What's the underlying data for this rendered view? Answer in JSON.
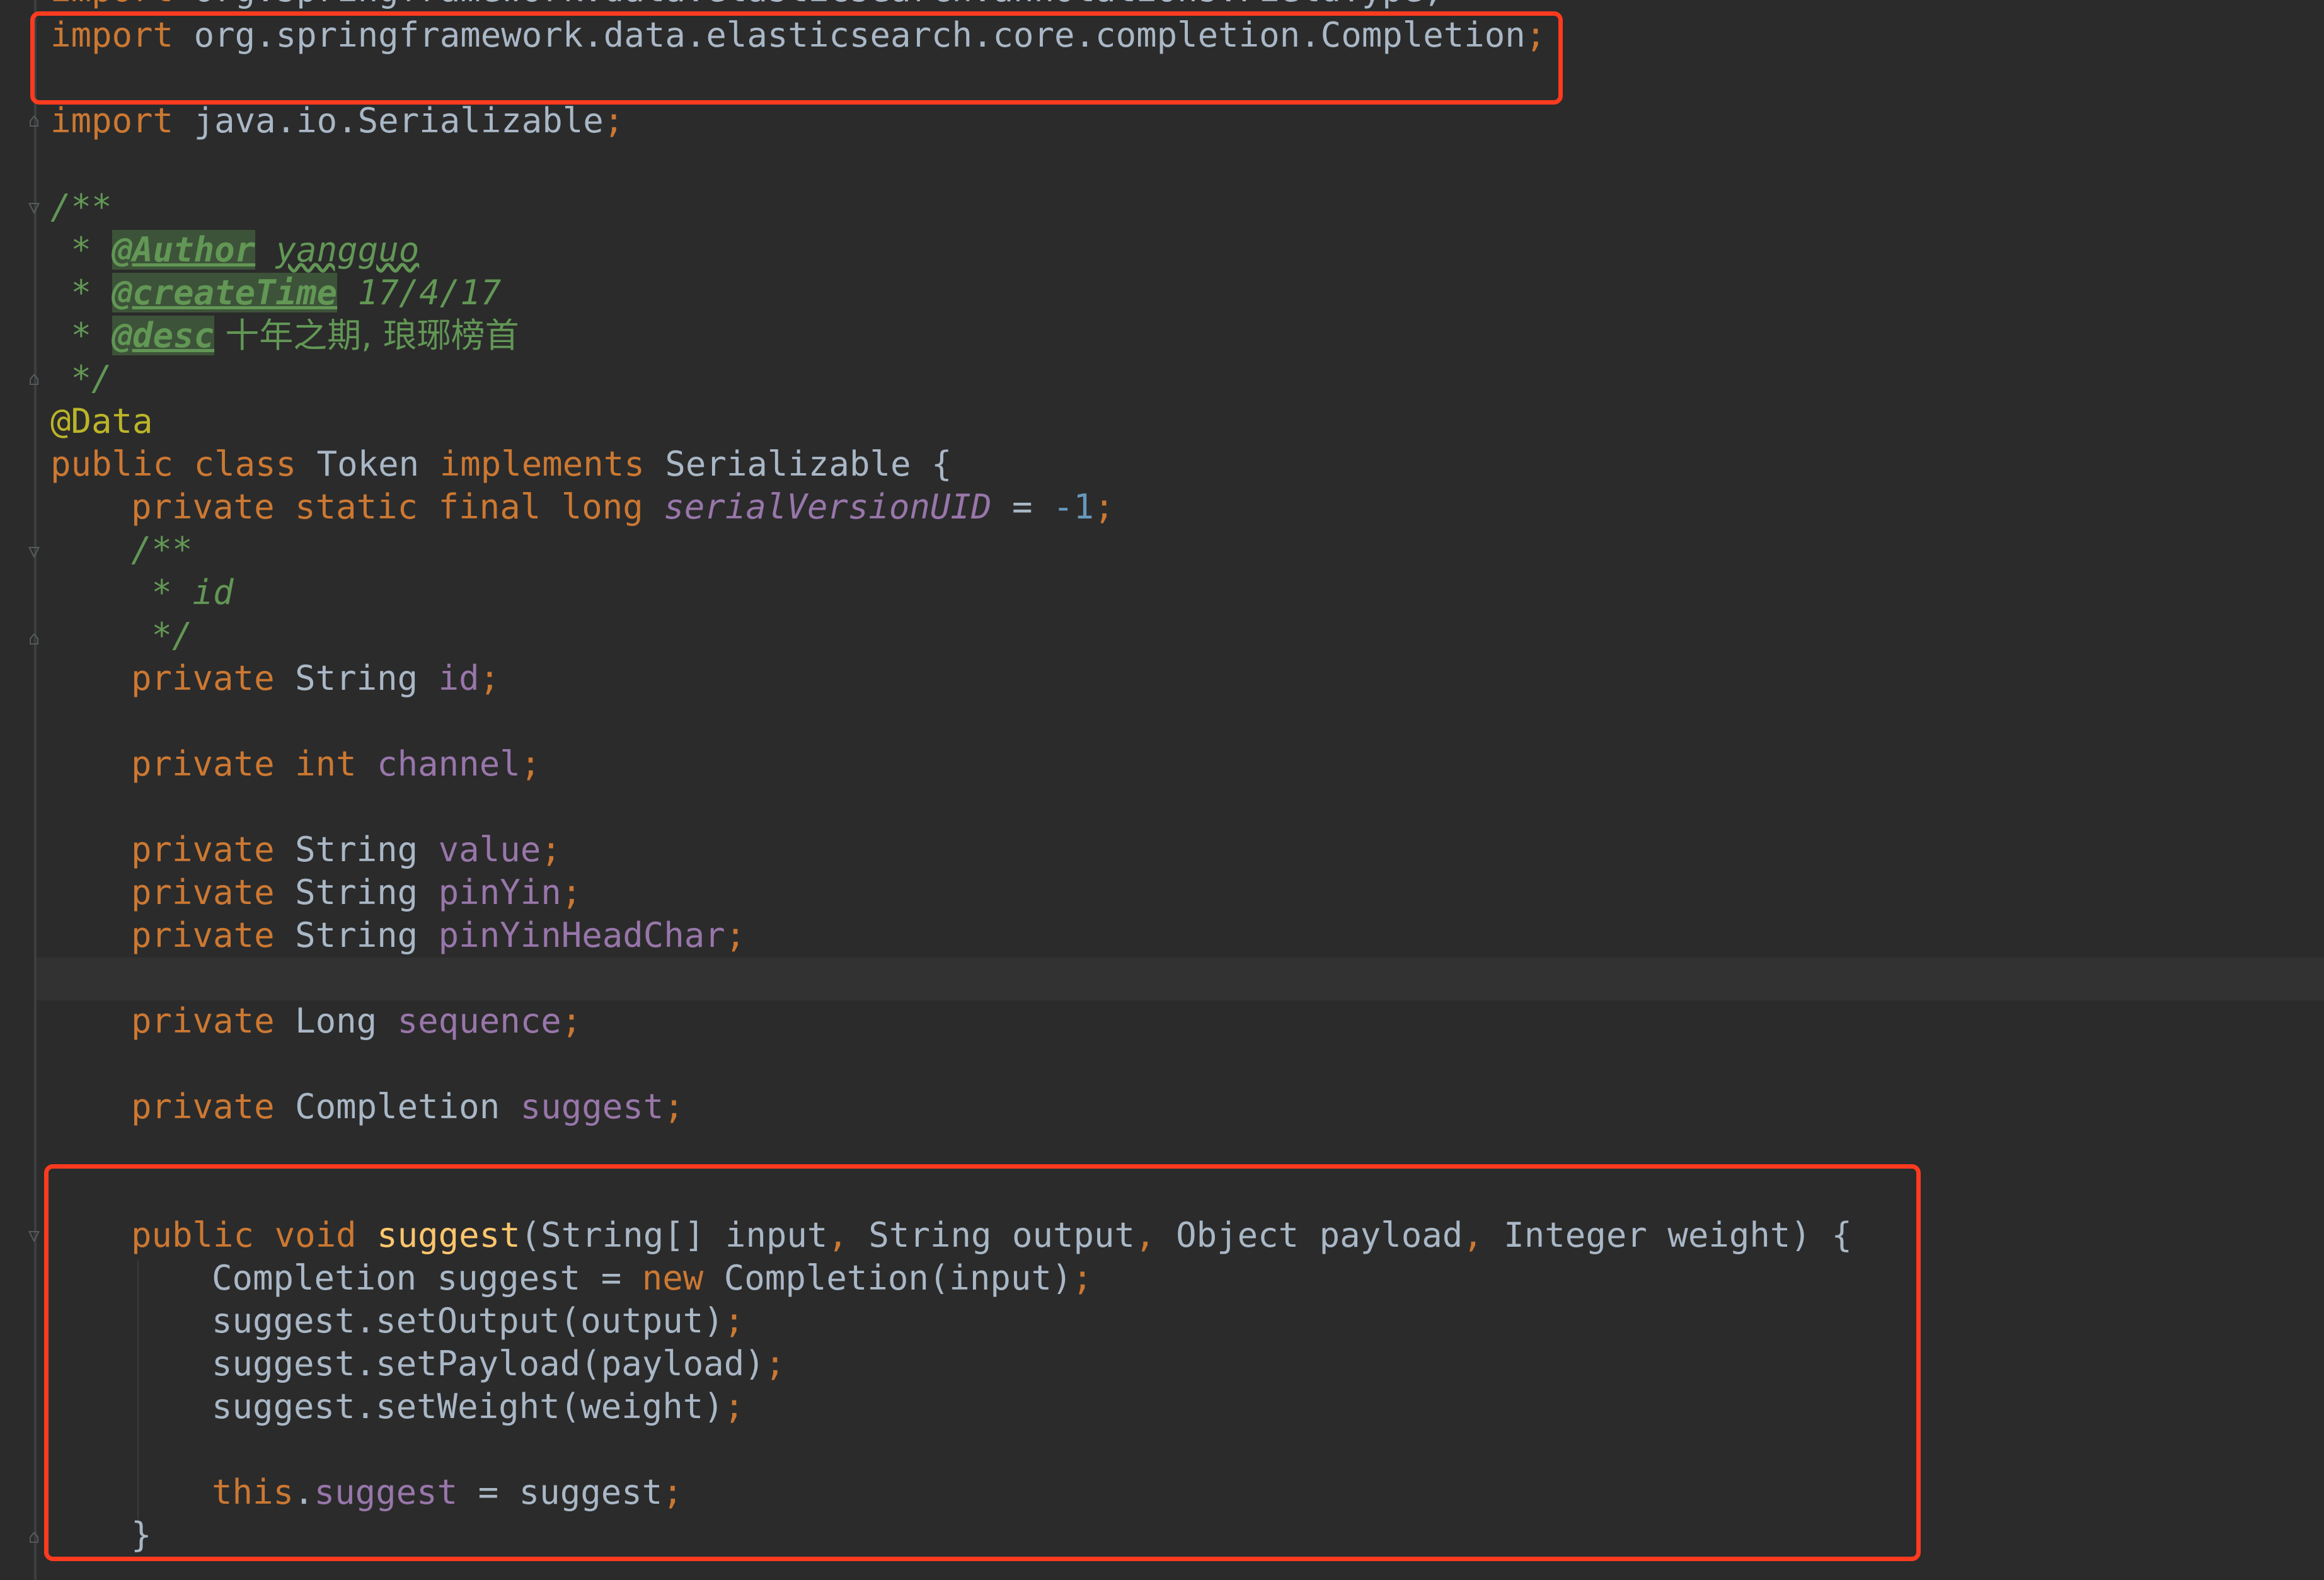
{
  "editor": {
    "cut_line": {
      "kw": "import",
      "rest": " org.springframework.data.elasticsearch.annotations.FieldType;"
    },
    "import_completion": {
      "kw": "import",
      "path": " org.springframework.data.elasticsearch.core.completion.Completion",
      "semi": ";"
    },
    "import_serializable": {
      "kw": "import",
      "path": " java.io.Serializable",
      "semi": ";"
    },
    "doc_open": "/**",
    "doc_author": {
      "star": " * ",
      "tag": "@Author",
      "value": "yangguo"
    },
    "doc_create": {
      "star": " * ",
      "tag": "@createTime",
      "value": " 17/4/17"
    },
    "doc_desc": {
      "star": " * ",
      "tag": "@desc",
      "value": " 十年之期, 琅琊榜首"
    },
    "doc_close": " */",
    "annotation": "@Data",
    "class_decl": {
      "kw1": "public class ",
      "name": "Token ",
      "kw2": "implements ",
      "iface": "Serializable {"
    },
    "serial": {
      "kw": "private static final long ",
      "field": "serialVersionUID",
      "eq": " = ",
      "num": "-1",
      "semi": ";"
    },
    "id_doc_open": "/**",
    "id_doc_body": " * id",
    "id_doc_close": " */",
    "field_id": {
      "kw": "private ",
      "type": "String ",
      "name": "id",
      "semi": ";"
    },
    "field_channel": {
      "kw": "private int ",
      "name": "channel",
      "semi": ";"
    },
    "field_value": {
      "kw": "private ",
      "type": "String ",
      "name": "value",
      "semi": ";"
    },
    "field_pinyin": {
      "kw": "private ",
      "type": "String ",
      "name": "pinYin",
      "semi": ";"
    },
    "field_pinyinhead": {
      "kw": "private ",
      "type": "String ",
      "name": "pinYinHeadChar",
      "semi": ";"
    },
    "field_sequence": {
      "kw": "private ",
      "type": "Long ",
      "name": "sequence",
      "semi": ";"
    },
    "field_suggest": {
      "kw": "private ",
      "type": "Completion ",
      "name": "suggest",
      "semi": ";"
    },
    "method_decl": {
      "kw": "public void ",
      "name": "suggest",
      "params_1": "(String[] input",
      "c1": ",",
      "params_2": " String output",
      "c2": ",",
      "params_3": " Object payload",
      "c3": ",",
      "params_4": " Integer weight) {"
    },
    "stmt_new": {
      "a": "Completion suggest = ",
      "kw": "new ",
      "b": "Completion(input)",
      "semi": ";"
    },
    "stmt_output": {
      "a": "suggest.setOutput(output)",
      "semi": ";"
    },
    "stmt_payload": {
      "a": "suggest.setPayload(payload)",
      "semi": ";"
    },
    "stmt_weight": {
      "a": "suggest.setWeight(weight)",
      "semi": ";"
    },
    "stmt_this": {
      "kw": "this",
      "dot": ".",
      "field": "suggest",
      "rest": " = suggest",
      "semi": ";"
    },
    "close_brace": "}"
  },
  "colors": {
    "background": "#2b2b2b",
    "keyword": "#cc7832",
    "plain": "#a9b7c6",
    "field": "#9876aa",
    "number": "#6897bb",
    "annotation": "#bbb529",
    "function": "#ffc66d",
    "doc_comment": "#629755",
    "highlight_box": "#ff3b1f"
  },
  "icons": [
    "fold-marker-icon"
  ]
}
